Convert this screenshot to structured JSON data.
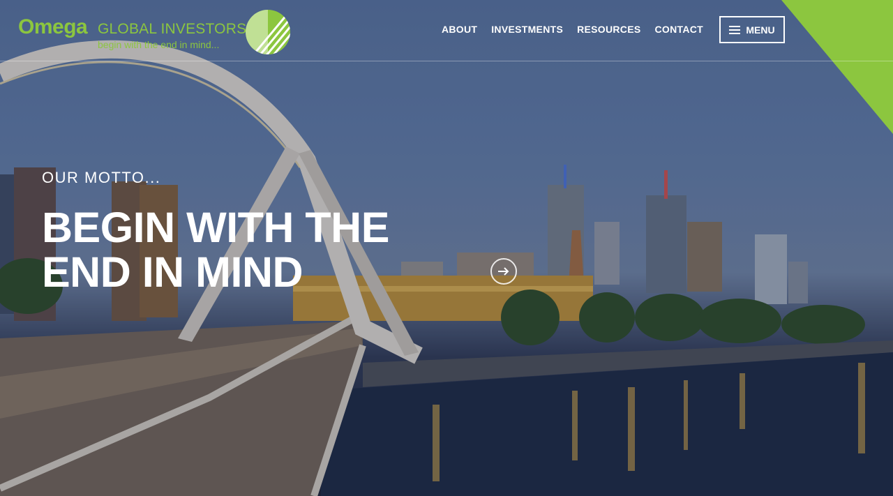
{
  "brand": {
    "name": "Omega",
    "subtitle": "GLOBAL INVESTORS",
    "tagline": "begin with the end in mind...",
    "accent_color": "#8cc63f",
    "logo_mark_icon": "striped-circle-logo-icon"
  },
  "nav": {
    "items": [
      {
        "label": "ABOUT"
      },
      {
        "label": "INVESTMENTS"
      },
      {
        "label": "RESOURCES"
      },
      {
        "label": "CONTACT"
      }
    ],
    "menu_label": "MENU",
    "menu_icon": "hamburger-icon"
  },
  "hero": {
    "eyebrow": "OUR MOTTO...",
    "headline": "BEGIN WITH THE END IN MIND",
    "next_icon": "arrow-right-icon",
    "background_description_icon": "city-bridge-photo"
  }
}
